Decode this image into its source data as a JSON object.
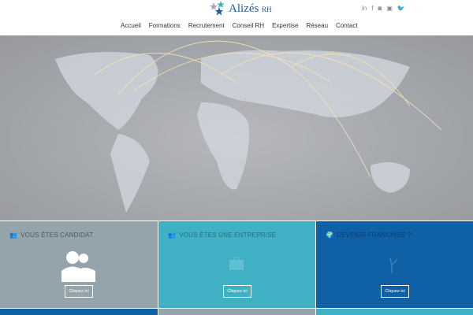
{
  "header": {
    "logo_text": "Alizés",
    "logo_suffix": "RH",
    "social": [
      {
        "icon": "linkedin-icon",
        "glyph": "in"
      },
      {
        "icon": "facebook-icon",
        "glyph": "f"
      },
      {
        "icon": "instagram-icon",
        "glyph": "◙"
      },
      {
        "icon": "youtube-icon",
        "glyph": "▣"
      },
      {
        "icon": "twitter-icon",
        "glyph": "🐦"
      }
    ]
  },
  "nav": {
    "items": [
      "Accueil",
      "Formations",
      "Recrutement",
      "Conseil RH",
      "Expertise",
      "Réseau",
      "Contact"
    ],
    "active": "Accueil"
  },
  "panels": [
    {
      "title": "VOUS ÊTES CANDIDAT",
      "button": "Cliquez-ici",
      "color": "#95a3aa",
      "title_color": "#4b5a63"
    },
    {
      "title": "VOUS ÊTES UNE ENTREPRISE",
      "button": "Cliquez-ici",
      "color": "#40b0c4",
      "title_color": "#2c6f7c"
    },
    {
      "title": "DEVENIR FRANCHISÉ ?",
      "button": "Cliquez-ici",
      "color": "#1060a6",
      "title_color": "#0a3f70"
    }
  ]
}
